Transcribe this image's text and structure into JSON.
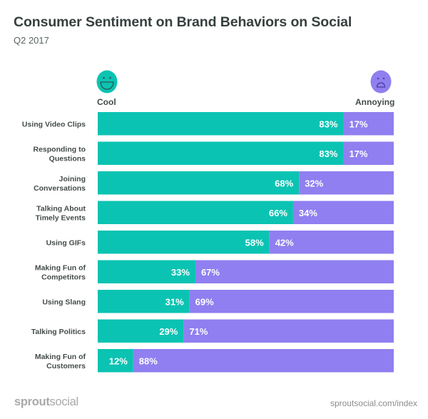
{
  "header": {
    "title": "Consumer Sentiment on Brand Behaviors on Social",
    "subtitle": "Q2 2017"
  },
  "legend": {
    "cool": {
      "label": "Cool",
      "icon": "smiley-face-icon",
      "color": "#0BC3B2"
    },
    "annoying": {
      "label": "Annoying",
      "icon": "frowning-face-icon",
      "color": "#8F7FF0"
    }
  },
  "footer": {
    "logo_bold": "sprout",
    "logo_light": "social",
    "url": "sproutsocial.com/index"
  },
  "chart_data": {
    "type": "bar",
    "orientation": "horizontal",
    "stacked": true,
    "title": "Consumer Sentiment on Brand Behaviors on Social",
    "subtitle": "Q2 2017",
    "xlabel": "",
    "ylabel": "",
    "xlim": [
      0,
      100
    ],
    "unit": "%",
    "grid": false,
    "legend_position": "top",
    "categories": [
      [
        "Using Video Clips"
      ],
      [
        "Responding to",
        "Questions"
      ],
      [
        "Joining",
        "Conversations"
      ],
      [
        "Talking About",
        "Timely Events"
      ],
      [
        "Using GIFs"
      ],
      [
        "Making Fun of",
        "Competitors"
      ],
      [
        "Using Slang"
      ],
      [
        "Talking Politics"
      ],
      [
        "Making Fun of",
        "Customers"
      ]
    ],
    "series": [
      {
        "name": "Cool",
        "color": "#0BC3B2",
        "values": [
          83,
          83,
          68,
          66,
          58,
          33,
          31,
          29,
          12
        ]
      },
      {
        "name": "Annoying",
        "color": "#8F7FF0",
        "values": [
          17,
          17,
          32,
          34,
          42,
          67,
          69,
          71,
          88
        ]
      }
    ]
  }
}
